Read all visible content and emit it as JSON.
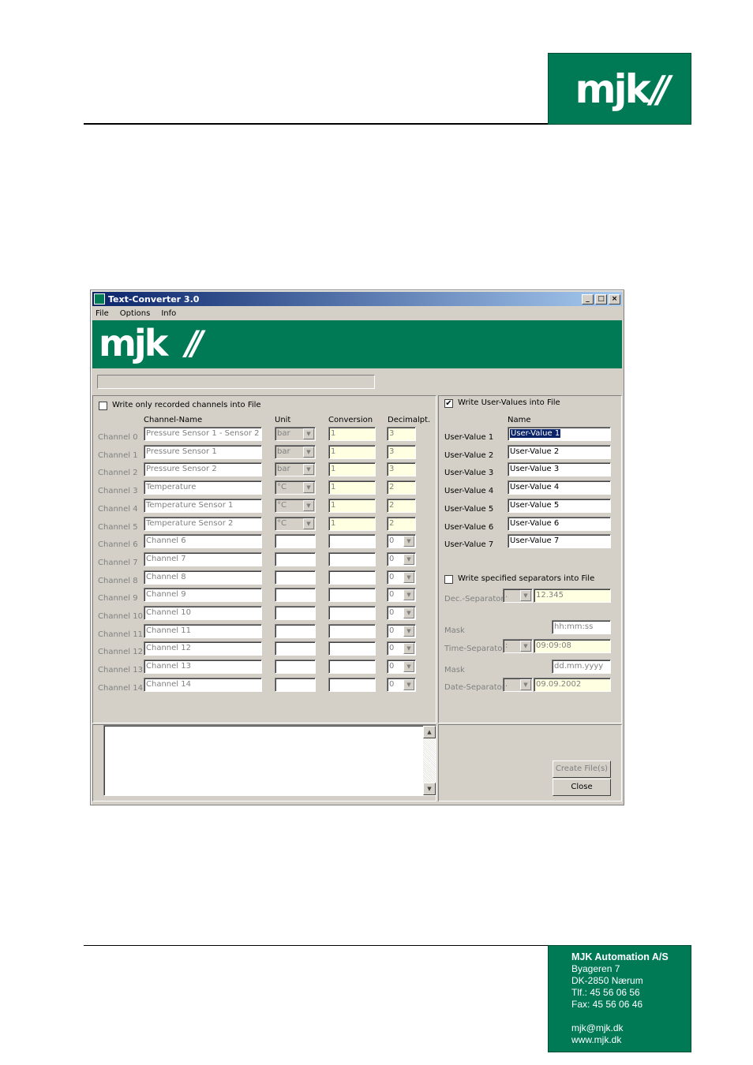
{
  "page": {
    "footer": {
      "company": "MJK Automation A/S",
      "address1": "Byageren 7",
      "address2": "DK-2850 Nærum",
      "phone": "Tlf.:  45 56 06 56",
      "fax": "Fax:  45 56 06 46",
      "email": "mjk@mjk.dk",
      "web": "www.mjk.dk"
    }
  },
  "window": {
    "title": "Text-Converter 3.0",
    "menu": [
      "File",
      "Options",
      "Info"
    ],
    "controls": {
      "minimize": "_",
      "maximize": "□",
      "close": "×"
    }
  },
  "left": {
    "write_recorded_label": "Write only recorded channels into File",
    "write_recorded_checked": false,
    "headers": {
      "name": "Channel-Name",
      "unit": "Unit",
      "conversion": "Conversion",
      "decimal": "Decimalpt."
    },
    "channels": [
      {
        "label": "Channel 0",
        "name": "Pressure Sensor 1 - Sensor 2",
        "unit": "bar",
        "conversion": "1",
        "decimal": "3"
      },
      {
        "label": "Channel 1",
        "name": "Pressure Sensor 1",
        "unit": "bar",
        "conversion": "1",
        "decimal": "3"
      },
      {
        "label": "Channel 2",
        "name": "Pressure Sensor 2",
        "unit": "bar",
        "conversion": "1",
        "decimal": "3"
      },
      {
        "label": "Channel 3",
        "name": "Temperature",
        "unit": "°C",
        "conversion": "1",
        "decimal": "2"
      },
      {
        "label": "Channel 4",
        "name": "Temperature Sensor 1",
        "unit": "°C",
        "conversion": "1",
        "decimal": "2"
      },
      {
        "label": "Channel 5",
        "name": "Temperature Sensor 2",
        "unit": "°C",
        "conversion": "1",
        "decimal": "2"
      },
      {
        "label": "Channel 6",
        "name": "Channel 6",
        "unit": "",
        "conversion": "",
        "decimal": "0"
      },
      {
        "label": "Channel 7",
        "name": "Channel 7",
        "unit": "",
        "conversion": "",
        "decimal": "0"
      },
      {
        "label": "Channel 8",
        "name": "Channel 8",
        "unit": "",
        "conversion": "",
        "decimal": "0"
      },
      {
        "label": "Channel 9",
        "name": "Channel 9",
        "unit": "",
        "conversion": "",
        "decimal": "0"
      },
      {
        "label": "Channel 10",
        "name": "Channel 10",
        "unit": "",
        "conversion": "",
        "decimal": "0"
      },
      {
        "label": "Channel 11",
        "name": "Channel 11",
        "unit": "",
        "conversion": "",
        "decimal": "0"
      },
      {
        "label": "Channel 12",
        "name": "Channel 12",
        "unit": "",
        "conversion": "",
        "decimal": "0"
      },
      {
        "label": "Channel 13",
        "name": "Channel 13",
        "unit": "",
        "conversion": "",
        "decimal": "0"
      },
      {
        "label": "Channel 14",
        "name": "Channel 14",
        "unit": "",
        "conversion": "",
        "decimal": "0"
      }
    ]
  },
  "right": {
    "write_user_values_label": "Write User-Values into File",
    "write_user_values_checked": true,
    "name_header": "Name",
    "user_values": [
      {
        "label": "User-Value 1",
        "value": "User-Value 1"
      },
      {
        "label": "User-Value 2",
        "value": "User-Value 2"
      },
      {
        "label": "User-Value 3",
        "value": "User-Value 3"
      },
      {
        "label": "User-Value 4",
        "value": "User-Value 4"
      },
      {
        "label": "User-Value 5",
        "value": "User-Value 5"
      },
      {
        "label": "User-Value 6",
        "value": "User-Value 6"
      },
      {
        "label": "User-Value 7",
        "value": "User-Value 7"
      }
    ],
    "write_separators_label": "Write specified separators into File",
    "write_separators_checked": false,
    "dec_separator_label": "Dec.-Separator",
    "dec_separator_value": ".",
    "dec_preview": "12.345",
    "mask_label": "Mask",
    "time_mask": "hh:mm:ss",
    "time_separator_label": "Time-Separator",
    "time_separator_value": ":",
    "time_preview": "09:09:08",
    "date_mask": "dd.mm.yyyy",
    "date_separator_label": "Date-Separator",
    "date_separator_value": ".",
    "date_preview": "09.09.2002"
  },
  "buttons": {
    "create": "Create File(s)",
    "close": "Close"
  }
}
